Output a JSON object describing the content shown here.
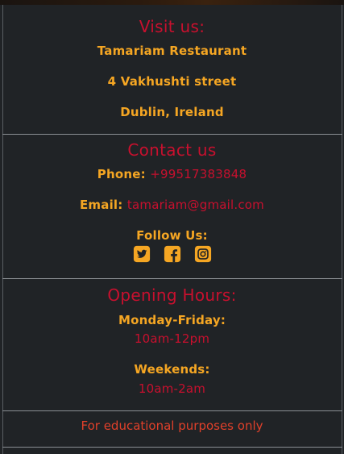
{
  "visit": {
    "heading": "Visit us:",
    "name": "Tamariam Restaurant",
    "street": "4 Vakhushti street",
    "city": "Dublin, Ireland"
  },
  "contact": {
    "heading": "Contact us",
    "phone_label": "Phone:",
    "phone_value": "+99517383848",
    "email_label": "Email:",
    "email_value": "tamariam@gmail.com",
    "follow_label": "Follow Us:",
    "social_icons": [
      "twitter-icon",
      "facebook-icon",
      "instagram-icon"
    ]
  },
  "hours": {
    "heading": "Opening Hours:",
    "weekday_label": "Monday-Friday:",
    "weekday_value": "10am-12pm",
    "weekend_label": "Weekends:",
    "weekend_value": "10am-2am"
  },
  "footer": {
    "note": "For educational purposes only"
  },
  "colors": {
    "background": "#202326",
    "accent_red": "#c8102e",
    "accent_orange": "#f5a623"
  }
}
